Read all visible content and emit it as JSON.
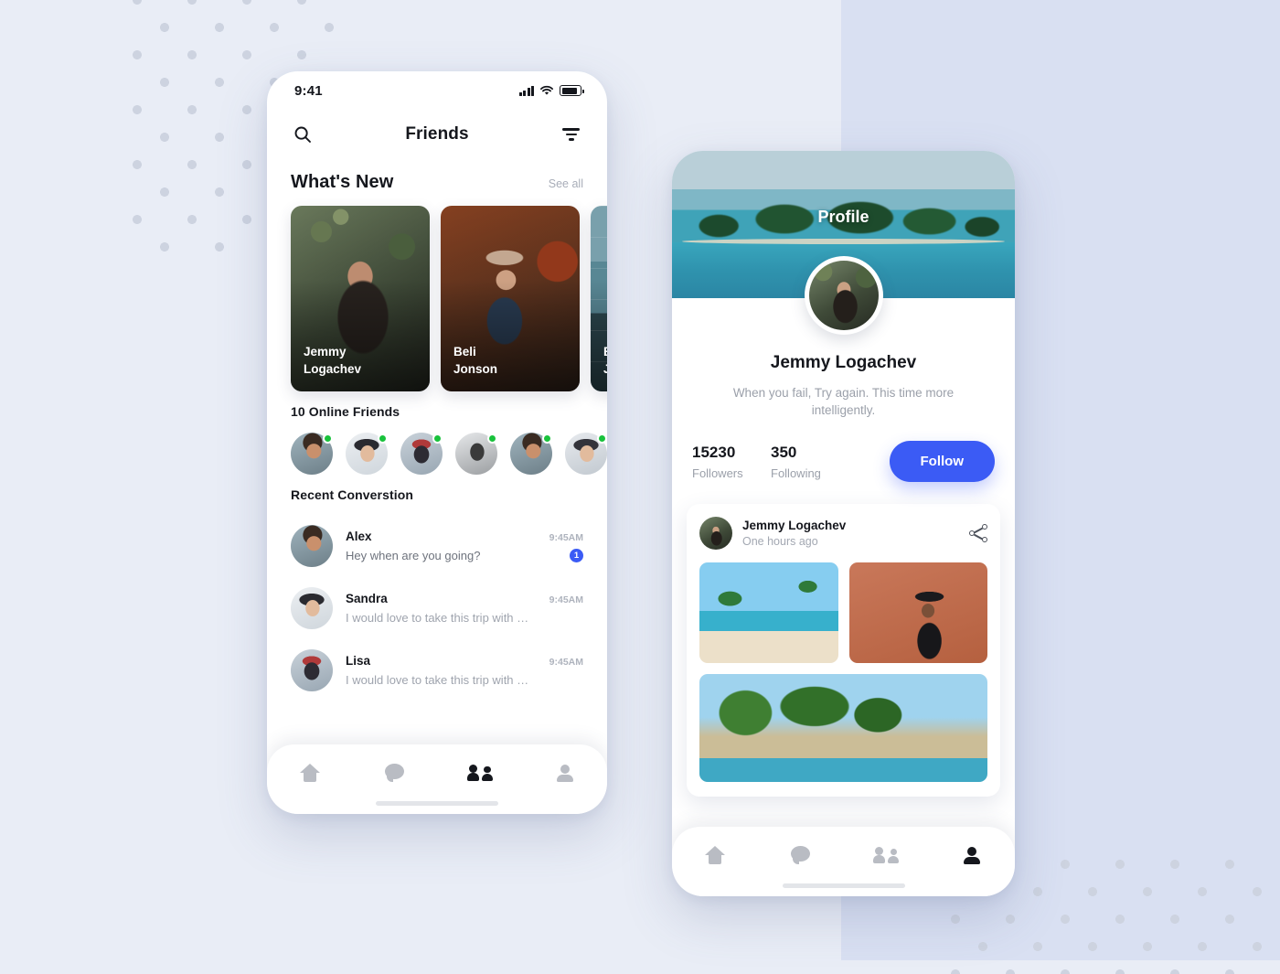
{
  "background": {
    "base_color": "#e9edf6",
    "panel_color": "#d9e0f2",
    "dot_color": "#cdd3e0"
  },
  "accent": {
    "brand_blue": "#3b5bf5",
    "online_green": "#19c23c"
  },
  "friends_screen": {
    "status_bar": {
      "time": "9:41",
      "signal_icon": "signal-bars-icon",
      "wifi_icon": "wifi-icon",
      "battery_icon": "battery-icon"
    },
    "app_bar": {
      "title": "Friends",
      "search_icon": "search-icon",
      "filter_icon": "filter-icon"
    },
    "whats_new": {
      "title": "What's New",
      "see_all": "See all",
      "stories": [
        {
          "name_line1": "Jemmy",
          "name_line2": "Logachev",
          "art": "art-jemmy"
        },
        {
          "name_line1": "Beli",
          "name_line2": "Jonson",
          "art": "art-beli"
        },
        {
          "name_line1": "Be",
          "name_line2": "Jo",
          "art": "art-third"
        }
      ]
    },
    "online": {
      "title": "10 Online Friends",
      "avatars": [
        {
          "art": "av-m1",
          "online": true
        },
        {
          "art": "av-w1",
          "online": true
        },
        {
          "art": "av-w2",
          "online": true
        },
        {
          "art": "av-m2",
          "online": true
        },
        {
          "art": "av-m3",
          "online": true
        },
        {
          "art": "av-w3",
          "online": true
        }
      ]
    },
    "recent": {
      "title": "Recent Converstion",
      "conversations": [
        {
          "name": "Alex",
          "message": "Hey when are you going?",
          "time": "9:45AM",
          "badge": "1",
          "art": "av-m1",
          "muted": false
        },
        {
          "name": "Sandra",
          "message": "I would love to take this trip with …",
          "time": "9:45AM",
          "badge": "",
          "art": "av-w1",
          "muted": true
        },
        {
          "name": "Lisa",
          "message": "I would love to take this trip with …",
          "time": "9:45AM",
          "badge": "",
          "art": "av-w2",
          "muted": true
        }
      ]
    },
    "tabs": [
      {
        "icon": "home-icon",
        "active": false
      },
      {
        "icon": "chat-icon",
        "active": false
      },
      {
        "icon": "people-icon",
        "active": true
      },
      {
        "icon": "person-icon",
        "active": false
      }
    ]
  },
  "profile_screen": {
    "cover_title": "Profile",
    "name": "Jemmy Logachev",
    "bio": "When you fail, Try again. This time more intelligently.",
    "stats": [
      {
        "value": "15230",
        "label": "Followers"
      },
      {
        "value": "350",
        "label": "Following"
      }
    ],
    "follow_label": "Follow",
    "post": {
      "author": "Jemmy Logachev",
      "time": "One hours ago",
      "share_icon": "share-icon",
      "images": [
        {
          "alt": "beach-with-palm-tree",
          "art": "img-beach"
        },
        {
          "alt": "man-in-hat-portrait",
          "art": "img-portrait"
        }
      ],
      "wide_image": {
        "alt": "tropical-beach-panorama"
      }
    },
    "tabs": [
      {
        "icon": "home-icon",
        "active": false
      },
      {
        "icon": "chat-icon",
        "active": false
      },
      {
        "icon": "people-icon",
        "active": false
      },
      {
        "icon": "person-icon",
        "active": true
      }
    ]
  }
}
